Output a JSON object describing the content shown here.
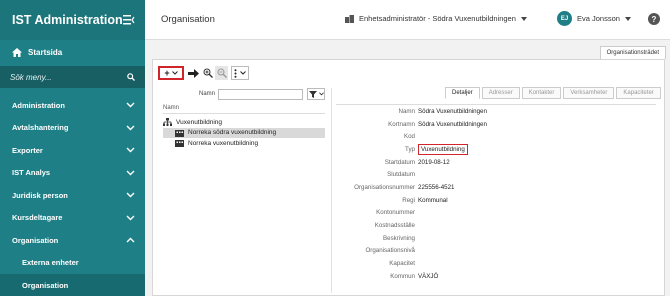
{
  "app": {
    "title": "IST Administration"
  },
  "sidebar": {
    "home_label": "Startsida",
    "search_placeholder": "Sök meny...",
    "items": [
      {
        "label": "Administration",
        "chevron": "down"
      },
      {
        "label": "Avtalshantering",
        "chevron": "down"
      },
      {
        "label": "Exporter",
        "chevron": "down"
      },
      {
        "label": "IST Analys",
        "chevron": "down"
      },
      {
        "label": "Juridisk person",
        "chevron": "down"
      },
      {
        "label": "Kursdeltagare",
        "chevron": "down"
      },
      {
        "label": "Organisation",
        "chevron": "up"
      },
      {
        "label": "Externa enheter",
        "chevron": ""
      },
      {
        "label": "Organisation",
        "chevron": ""
      }
    ]
  },
  "header": {
    "page_title": "Organisation",
    "role": "Enhetsadministratör - Södra Vuxenutbildningen",
    "user_initials": "EJ",
    "user_name": "Eva Jonsson",
    "help": "?"
  },
  "content_tab": "Organisationsträdet",
  "toolbar": {
    "add_label": "+"
  },
  "filter": {
    "name_label": "Namn"
  },
  "tree": {
    "column_header": "Namn",
    "rows": [
      {
        "label": "Vuxenutbildning",
        "level": 0,
        "selected": false
      },
      {
        "label": "Norreka södra vuxenutbildning",
        "level": 1,
        "selected": true
      },
      {
        "label": "Norreka vuxenutbildning",
        "level": 1,
        "selected": false
      }
    ]
  },
  "tabs": [
    "Detaljer",
    "Adresser",
    "Kontakter",
    "Verksamheter",
    "Kapaciteter"
  ],
  "details": {
    "rows": [
      {
        "label": "Namn",
        "value": "Södra Vuxenutbildningen"
      },
      {
        "label": "Kortnamn",
        "value": "Södra Vuxenutbildningen"
      },
      {
        "label": "Kod",
        "value": ""
      },
      {
        "label": "Typ",
        "value": "Vuxenutbildning"
      },
      {
        "label": "Startdatum",
        "value": "2019-08-12"
      },
      {
        "label": "Slutdatum",
        "value": ""
      },
      {
        "label": "Organisationsnummer",
        "value": "225556-4521"
      },
      {
        "label": "Regi",
        "value": "Kommunal"
      },
      {
        "label": "Kontonummer",
        "value": ""
      },
      {
        "label": "Kostnadsställe",
        "value": ""
      },
      {
        "label": "Beskrivning",
        "value": ""
      },
      {
        "label": "Organisationsnivå",
        "value": ""
      },
      {
        "label": "Kapacitet",
        "value": ""
      },
      {
        "label": "Kommun",
        "value": "VÄXJÖ"
      }
    ]
  },
  "colors": {
    "sidebar": "#1f7f86",
    "highlight": "#d0262b"
  }
}
